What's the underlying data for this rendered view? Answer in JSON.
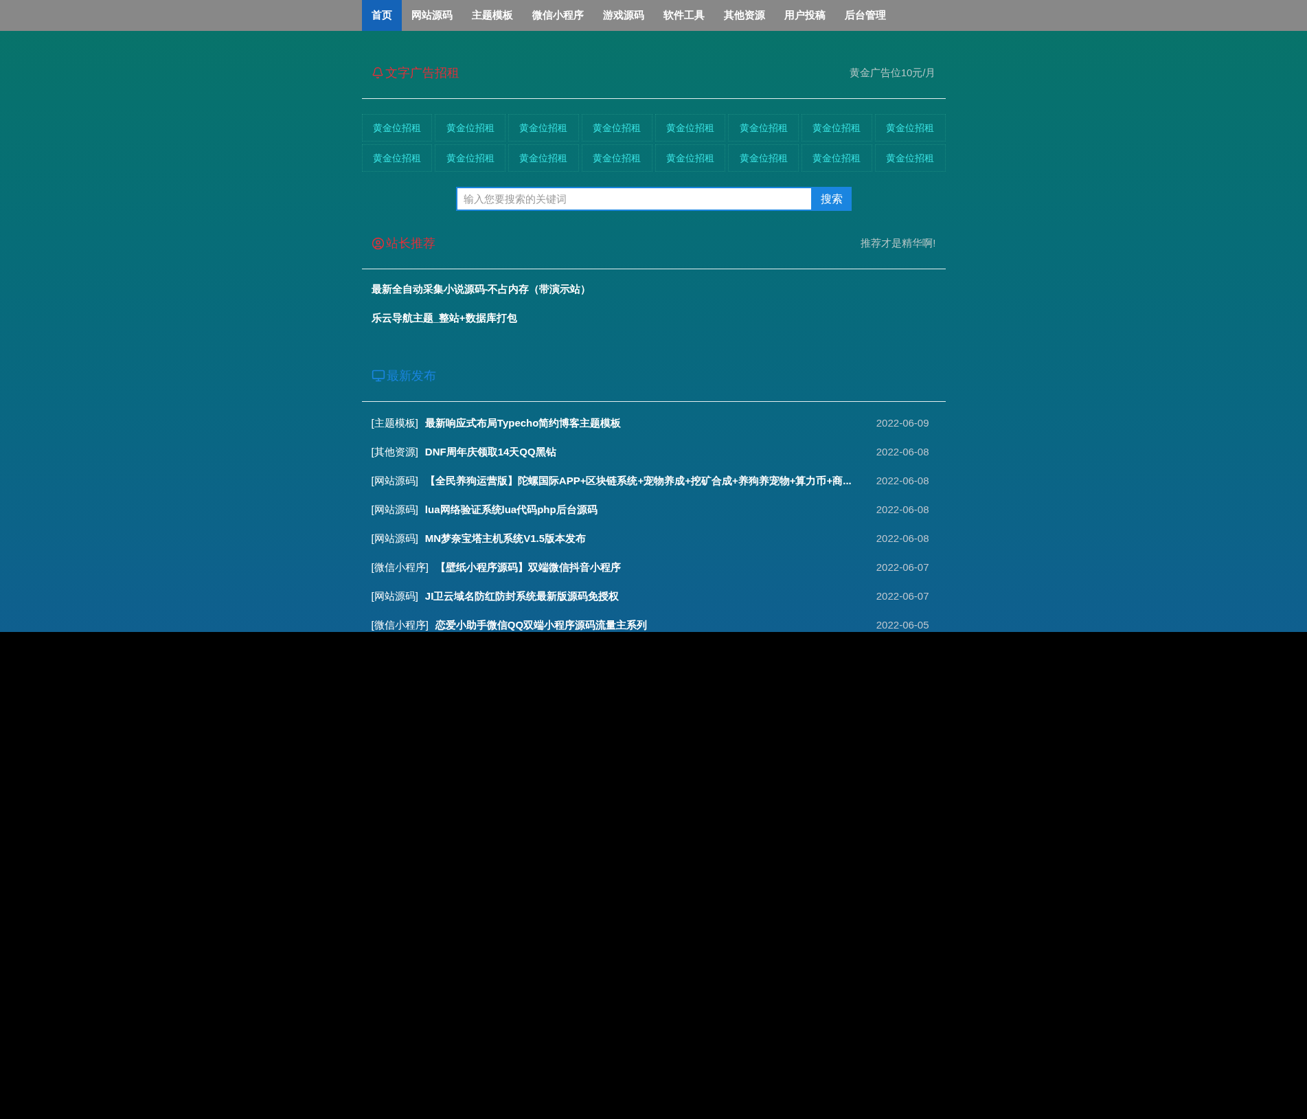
{
  "nav": [
    {
      "label": "首页",
      "selected": true
    },
    {
      "label": "网站源码",
      "selected": false
    },
    {
      "label": "主题模板",
      "selected": false
    },
    {
      "label": "微信小程序",
      "selected": false
    },
    {
      "label": "游戏源码",
      "selected": false
    },
    {
      "label": "软件工具",
      "selected": false
    },
    {
      "label": "其他资源",
      "selected": false
    },
    {
      "label": "用户投稿",
      "selected": false
    },
    {
      "label": "后台管理",
      "selected": false
    }
  ],
  "ads": {
    "title": "文字广告招租",
    "note": "黄金广告位10元/月",
    "cells": [
      "黄金位招租",
      "黄金位招租",
      "黄金位招租",
      "黄金位招租",
      "黄金位招租",
      "黄金位招租",
      "黄金位招租",
      "黄金位招租",
      "黄金位招租",
      "黄金位招租",
      "黄金位招租",
      "黄金位招租",
      "黄金位招租",
      "黄金位招租",
      "黄金位招租",
      "黄金位招租"
    ]
  },
  "search": {
    "placeholder": "输入您要搜索的关键词",
    "button": "搜索"
  },
  "recommend": {
    "title": "站长推荐",
    "note": "推荐才是精华啊!",
    "items": [
      "最新全自动采集小说源码-不占内存（带演示站）",
      "乐云导航主题_整站+数据库打包"
    ]
  },
  "latest": {
    "title": "最新发布",
    "rows": [
      {
        "category": "[主题模板]",
        "title": "最新响应式布局Typecho简约博客主题模板",
        "date": "2022-06-09"
      },
      {
        "category": "[其他资源]",
        "title": "DNF周年庆领取14天QQ黑钻",
        "date": "2022-06-08"
      },
      {
        "category": "[网站源码]",
        "title": "【全民养狗运营版】陀螺国际APP+区块链系统+宠物养成+挖矿合成+养狗养宠物+算力币+商...",
        "date": "2022-06-08"
      },
      {
        "category": "[网站源码]",
        "title": "lua网络验证系统lua代码php后台源码",
        "date": "2022-06-08"
      },
      {
        "category": "[网站源码]",
        "title": "MN梦奈宝塔主机系统V1.5版本发布",
        "date": "2022-06-08"
      },
      {
        "category": "[微信小程序]",
        "title": "【壁纸小程序源码】双端微信抖音小程序",
        "date": "2022-06-07"
      },
      {
        "category": "[网站源码]",
        "title": "JI卫云域名防红防封系统最新版源码免授权",
        "date": "2022-06-07"
      },
      {
        "category": "[微信小程序]",
        "title": "恋爱小助手微信QQ双端小程序源码流量主系列",
        "date": "2022-06-05"
      }
    ]
  }
}
